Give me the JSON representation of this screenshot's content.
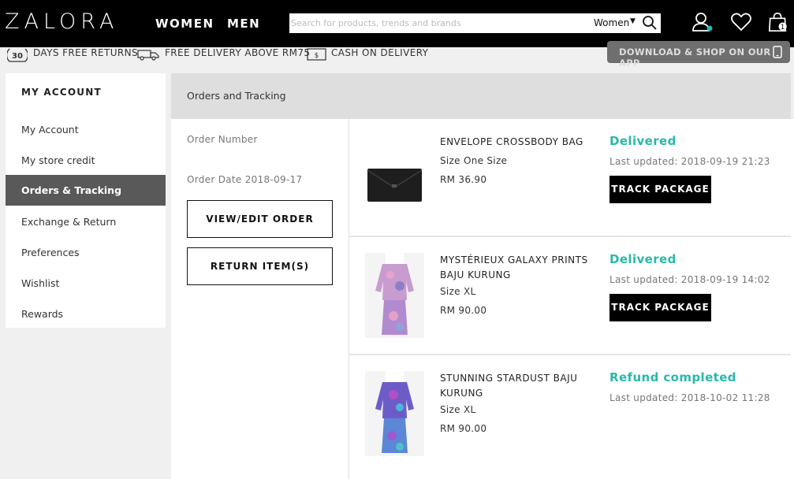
{
  "header": {
    "logo": "ZALORA",
    "nav": [
      "WOMEN",
      "MEN"
    ],
    "search_placeholder": "Search for products, trends and brands",
    "search_gender": "Women",
    "cart_count": "1",
    "user_status_color": "#2ab8a9"
  },
  "benefits": [
    {
      "icon": "30-days-badge-icon",
      "badge": "30",
      "label": "DAYS FREE RETURNS"
    },
    {
      "icon": "delivery-truck-icon",
      "label": "FREE DELIVERY ABOVE RM75"
    },
    {
      "icon": "cash-note-icon",
      "badge": "$",
      "label": "CASH ON DELIVERY"
    }
  ],
  "app_button": "DOWNLOAD & SHOP ON OUR APP",
  "sidebar": {
    "title": "MY ACCOUNT",
    "items": [
      "My Account",
      "My store credit",
      "Orders & Tracking",
      "Exchange & Return",
      "Preferences",
      "Wishlist",
      "Rewards"
    ],
    "active": "Orders & Tracking"
  },
  "main": {
    "heading": "Orders and Tracking",
    "order_number_label": "Order Number",
    "order_date": "Order Date 2018-09-17",
    "view_edit_button": "VIEW/EDIT ORDER",
    "return_button": "RETURN ITEM(S)",
    "items": [
      {
        "name": "ENVELOPE CROSSBODY BAG",
        "size": "Size One Size",
        "price": "RM 36.90",
        "status": "Delivered",
        "updated": "Last updated: 2018-09-19 21:23",
        "action": "TRACK PACKAGE"
      },
      {
        "name": "MYSTÉRIEUX GALAXY PRINTS BAJU KURUNG",
        "size": "Size XL",
        "price": "RM 90.00",
        "status": "Delivered",
        "updated": "Last updated: 2018-09-19 14:02",
        "action": "TRACK PACKAGE"
      },
      {
        "name": "STUNNING STARDUST BAJU KURUNG",
        "size": "Size XL",
        "price": "RM 90.00",
        "status": "Refund completed",
        "updated": "Last updated: 2018-10-02 11:28"
      }
    ]
  },
  "colors": {
    "accent": "#2ab8a9",
    "header_bg": "#000000",
    "sidebar_active": "#595959"
  }
}
